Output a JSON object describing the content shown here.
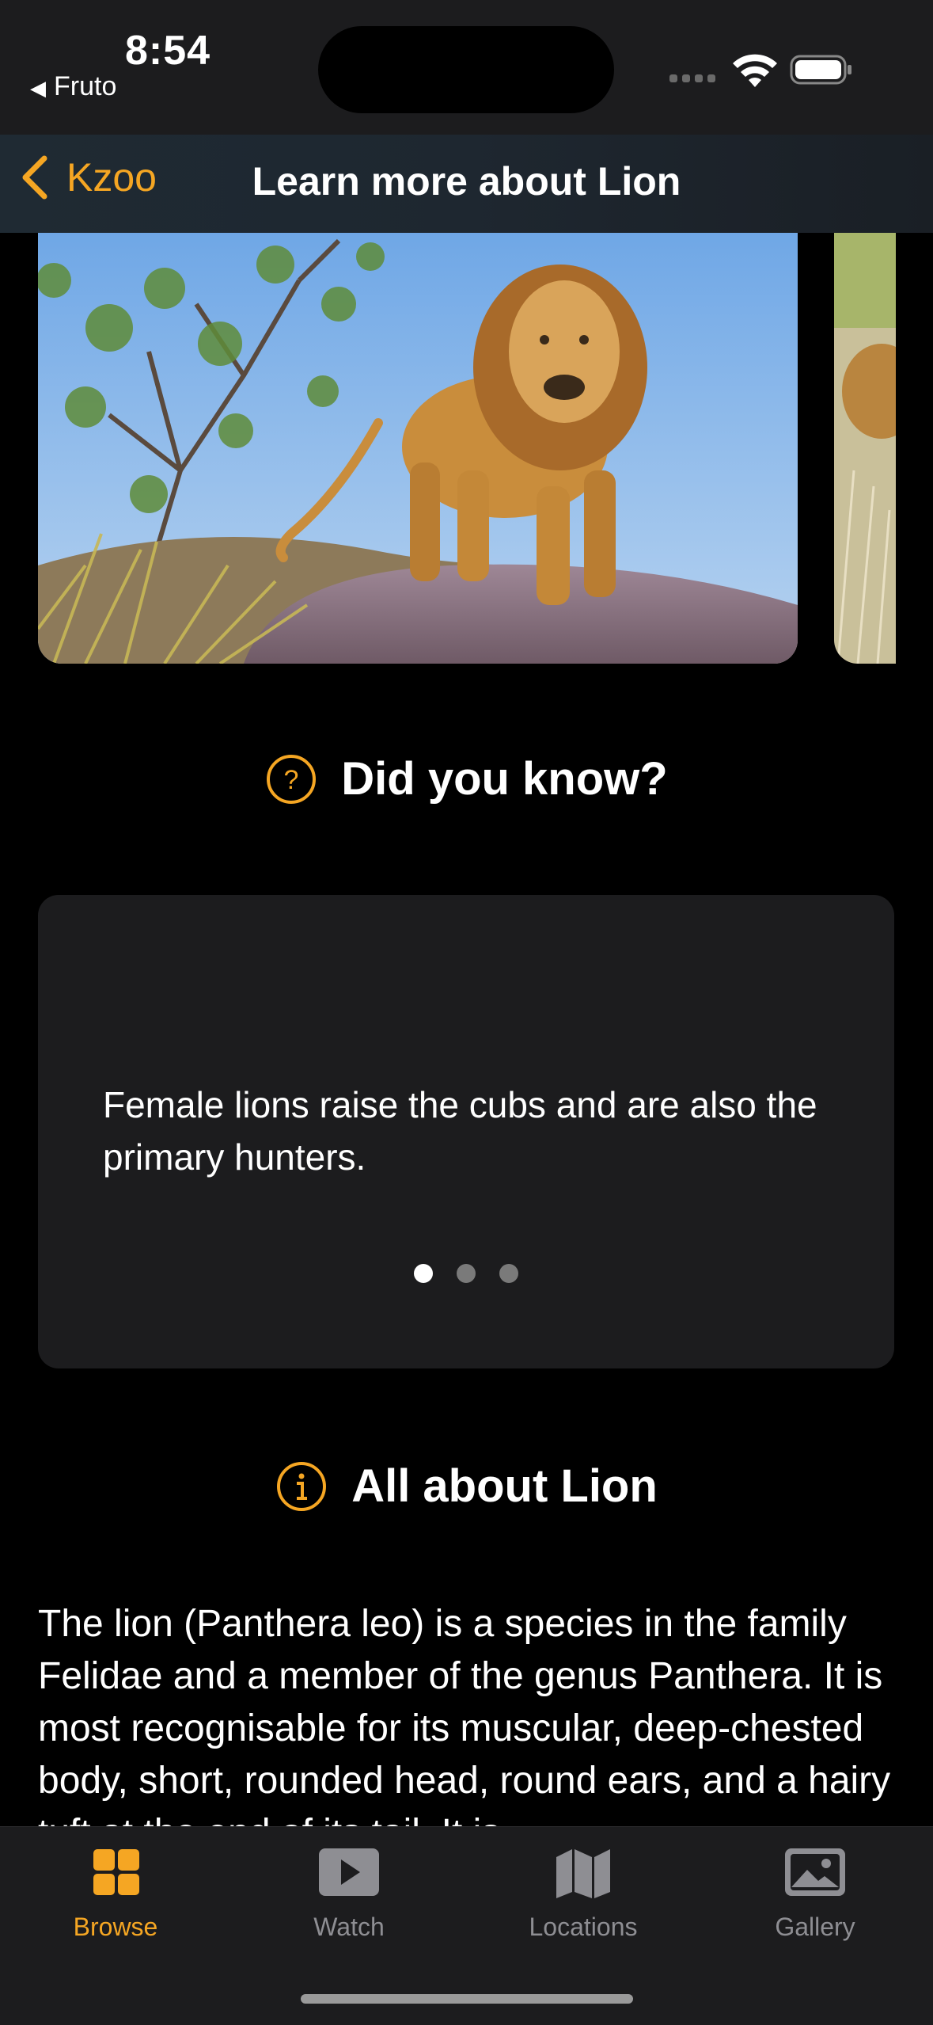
{
  "status_bar": {
    "time": "8:54",
    "back_app": "Fruto"
  },
  "nav": {
    "back_label": "Kzoo",
    "title": "Learn more about Lion"
  },
  "did_you_know": {
    "title": "Did you know?",
    "fact": "Female lions raise the cubs and are also the primary hunters.",
    "pages": 3,
    "current_page": 1
  },
  "about": {
    "title": "All about Lion",
    "text": "The lion (Panthera leo) is a species in the family Felidae and a member of the genus Panthera. It is most recognisable for its muscular, deep-chested body, short, rounded head, round ears, and a hairy tuft at the end of its tail. It is"
  },
  "tabs": [
    {
      "label": "Browse",
      "icon": "grid-icon",
      "active": true
    },
    {
      "label": "Watch",
      "icon": "play-icon",
      "active": false
    },
    {
      "label": "Locations",
      "icon": "map-icon",
      "active": false
    },
    {
      "label": "Gallery",
      "icon": "photo-icon",
      "active": false
    }
  ],
  "colors": {
    "accent": "#f5a623",
    "background": "#000000",
    "card": "#1c1c1e"
  }
}
